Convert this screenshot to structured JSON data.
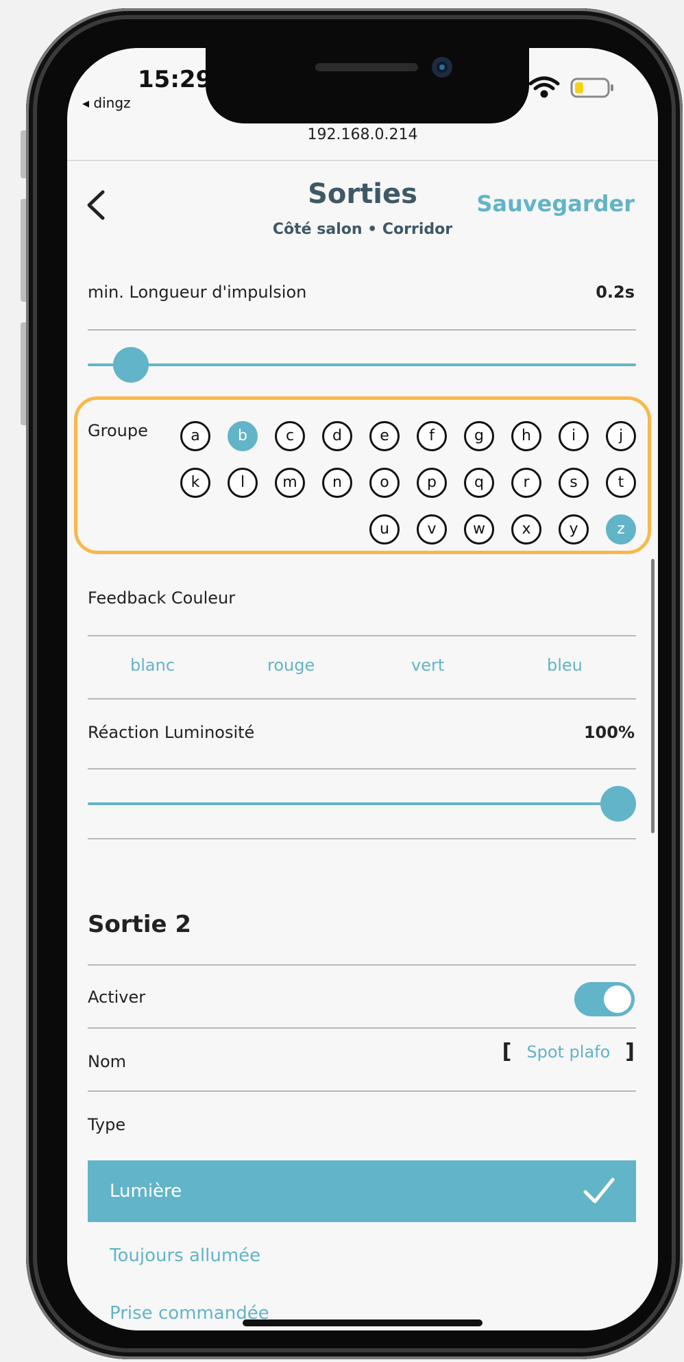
{
  "status_bar": {
    "time": "15:29",
    "back_app": "◂ dingz"
  },
  "browser": {
    "url": "192.168.0.214"
  },
  "header": {
    "title": "Sorties",
    "subtitle": "Côté salon • Corridor",
    "save_label": "Sauvegarder",
    "back_icon": "chevron-left-icon"
  },
  "impulse": {
    "label": "min. Longueur d'impulsion",
    "value": "0.2s",
    "slider_fraction": 0.05
  },
  "group": {
    "label": "Groupe",
    "letters": [
      "a",
      "b",
      "c",
      "d",
      "e",
      "f",
      "g",
      "h",
      "i",
      "j",
      "k",
      "l",
      "m",
      "n",
      "o",
      "p",
      "q",
      "r",
      "s",
      "t",
      "u",
      "v",
      "w",
      "x",
      "y",
      "z"
    ],
    "selected": [
      "b",
      "z"
    ],
    "highlight_color": "#f9b84b"
  },
  "feedback": {
    "label": "Feedback Couleur",
    "options": [
      "blanc",
      "rouge",
      "vert",
      "bleu"
    ]
  },
  "luminosity": {
    "label": "Réaction Luminosité",
    "value": "100%",
    "slider_fraction": 1.0
  },
  "output2": {
    "title": "Sortie 2",
    "activate_label": "Activer",
    "activate_on": true,
    "name_label": "Nom",
    "name_value": "Spot plafo",
    "type_label": "Type",
    "type_options": [
      "Lumière",
      "Toujours allumée",
      "Prise commandée"
    ],
    "type_selected": "Lumière"
  },
  "colors": {
    "accent": "#62b4c8",
    "title": "#3e5866"
  }
}
